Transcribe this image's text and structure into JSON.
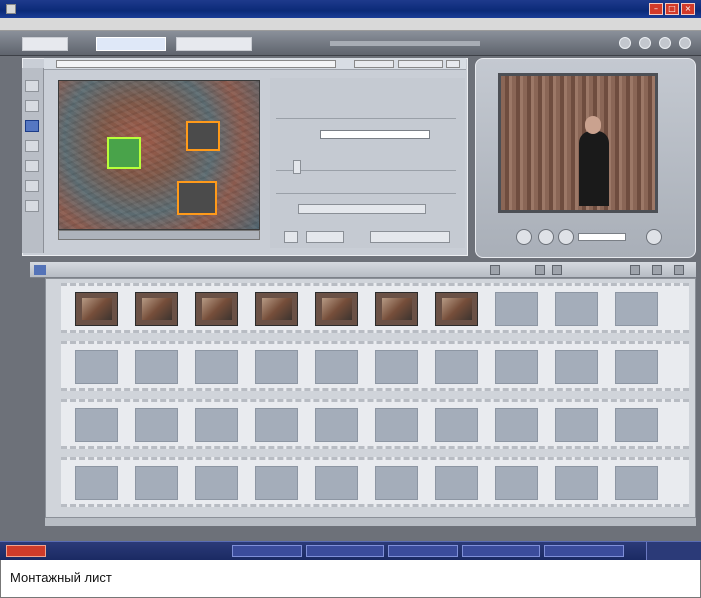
{
  "caption": "Монтажный лист",
  "colors": {
    "accent": "#1e3a8c",
    "selected_tool": "#5577c2",
    "clip_border": "#ff9a1a",
    "active_clip_border": "#b8ff3a"
  },
  "icons": {
    "titlebar_app": "app-icon",
    "timeline_left": "storyboard-view-icon",
    "mode_icons": [
      "help-icon",
      "settings-icon",
      "info-icon",
      "camera-icon"
    ],
    "tools": [
      "select-icon",
      "trim-icon",
      "pen-icon",
      "effects-icon",
      "audio-icon",
      "text-icon",
      "split-icon"
    ]
  },
  "storyboard": {
    "rows": 4,
    "cells_per_row": 10,
    "clip_count": 7
  }
}
